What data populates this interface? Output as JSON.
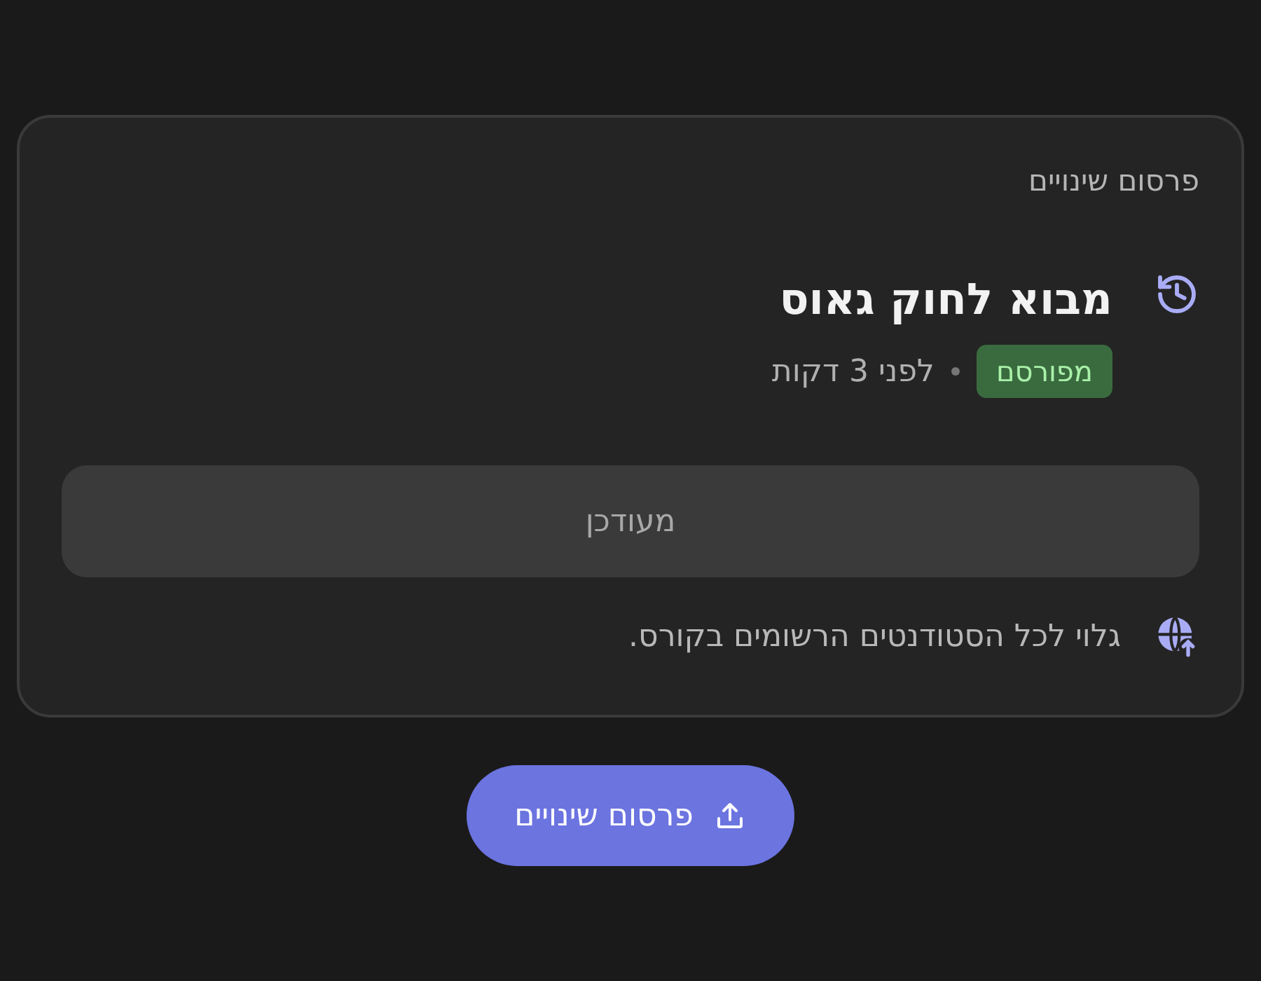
{
  "card": {
    "heading": "פרסום שינויים",
    "title": "מבוא לחוק גאוס",
    "badge": {
      "label": "מפורסם",
      "color": "#3a6b3f"
    },
    "time": "לפני 3 דקות",
    "status_button": {
      "label": "מעודכן",
      "disabled": true
    },
    "visibility": "גלוי לכל הסטודנטים הרשומים בקורס."
  },
  "publish_button": {
    "label": "פרסום שינויים",
    "disabled": false
  }
}
